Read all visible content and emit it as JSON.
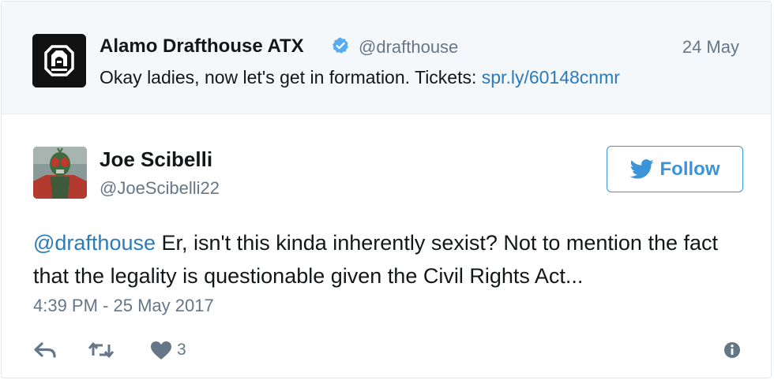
{
  "quoted_tweet": {
    "author_name": "Alamo Drafthouse ATX",
    "handle": "@drafthouse",
    "date": "24 May",
    "text": "Okay ladies, now let's get in formation. Tickets: ",
    "link": "spr.ly/60148cnmr",
    "verified": true,
    "avatar_icon": "alamo-drafthouse-logo"
  },
  "tweet": {
    "author_name": "Joe Scibelli",
    "handle": "@JoeScibelli22",
    "mention": "@drafthouse",
    "text": " Er, isn't this kinda inherently sexist? Not to mention the fact that the legality is questionable given the Civil Rights Act...",
    "timestamp": "4:39 PM - 25 May 2017",
    "follow_label": "Follow",
    "like_count": "3"
  },
  "icons": {
    "reply": "reply-icon",
    "retweet": "retweet-icon",
    "like": "heart-icon",
    "info": "info-icon",
    "verified": "verified-badge-icon",
    "follow": "twitter-bird-icon"
  },
  "colors": {
    "link_blue": "#2b7bb9",
    "follow_blue": "#3b94d9",
    "verified_blue": "#55acee",
    "muted_gray": "#657786",
    "quoted_bg": "#f5f8fa"
  }
}
